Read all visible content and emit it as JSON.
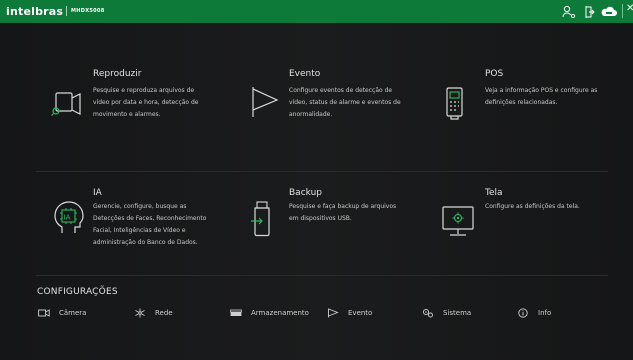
{
  "topbar": {
    "logo": "intelbras",
    "model": "MHDX5008",
    "bg_color": "#0e7a3a"
  },
  "tiles": [
    {
      "title": "Reproduzir",
      "desc": [
        "Pesquise e reproduza arquivos de",
        "vídeo por data e hora, detecção de",
        "movimento e alarmes."
      ],
      "icon": "camera-playback-icon"
    },
    {
      "title": "Evento",
      "desc": [
        "Configure eventos de detecção de",
        "vídeo, status de alarme e eventos de",
        "anormalidade."
      ],
      "icon": "flag-icon"
    },
    {
      "title": "POS",
      "desc": [
        "Veja a informação POS e configure as",
        "definições relacionadas."
      ],
      "icon": "pos-terminal-icon"
    },
    {
      "title": "IA",
      "desc": [
        "Gerencie, configure, busque as",
        "Detecções de Faces, Reconhecimento",
        " Facial, Inteligências de Vídeo e",
        "administração do Banco de Dados."
      ],
      "icon": "ai-head-icon"
    },
    {
      "title": "Backup",
      "desc": [
        "Pesquise e faça backup de arquivos",
        "em dispositivos USB."
      ],
      "icon": "usb-backup-icon"
    },
    {
      "title": "Tela",
      "desc": [
        "Configure as definições da tela."
      ],
      "icon": "monitor-settings-icon"
    }
  ],
  "config": {
    "title": "CONFIGURAÇÕES",
    "items": [
      {
        "label": "Câmera",
        "icon": "camera-icon"
      },
      {
        "label": "Rede",
        "icon": "network-icon"
      },
      {
        "label": "Armazenamento",
        "icon": "storage-icon"
      },
      {
        "label": "Evento",
        "icon": "flag-icon"
      },
      {
        "label": "Sistema",
        "icon": "gears-icon"
      },
      {
        "label": "Info",
        "icon": "info-icon"
      }
    ]
  }
}
